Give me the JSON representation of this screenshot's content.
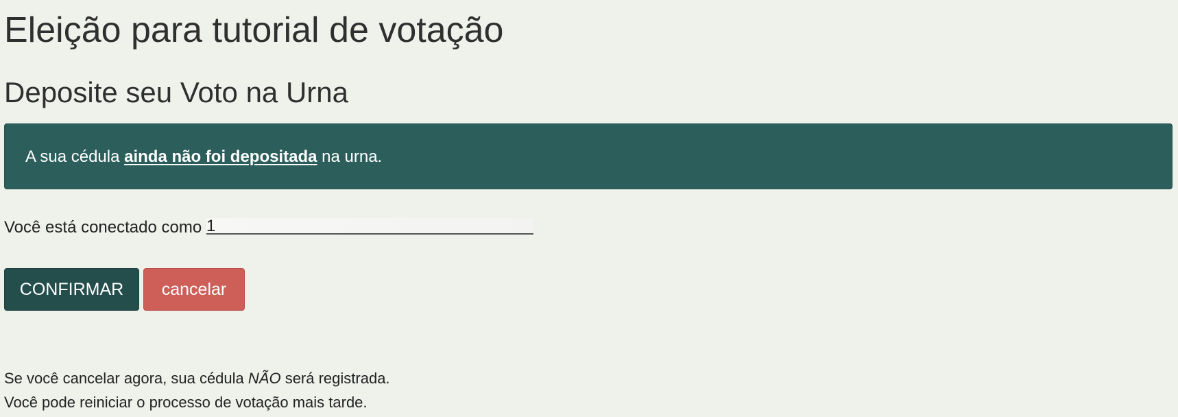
{
  "page": {
    "title": "Eleição para tutorial de votação",
    "section_title": "Deposite seu Voto na Urna"
  },
  "alert": {
    "prefix": "A sua cédula ",
    "emphasis": "ainda não foi depositada",
    "suffix": " na urna.",
    "background_color": "#2c5f5c"
  },
  "connection": {
    "label": "Você está conectado como ",
    "user_visible_start": "1",
    "user_obscured": "                     "
  },
  "actions": {
    "confirm_label": "CONFIRMAR",
    "confirm_color": "#244e4c",
    "cancel_label": "cancelar",
    "cancel_color": "#cd5f58"
  },
  "notes": {
    "line1_prefix": "Se você cancelar agora, sua cédula ",
    "line1_emphasis": "NÃO",
    "line1_suffix": " será registrada.",
    "line2": "Você pode reiniciar o processo de votação mais tarde."
  }
}
